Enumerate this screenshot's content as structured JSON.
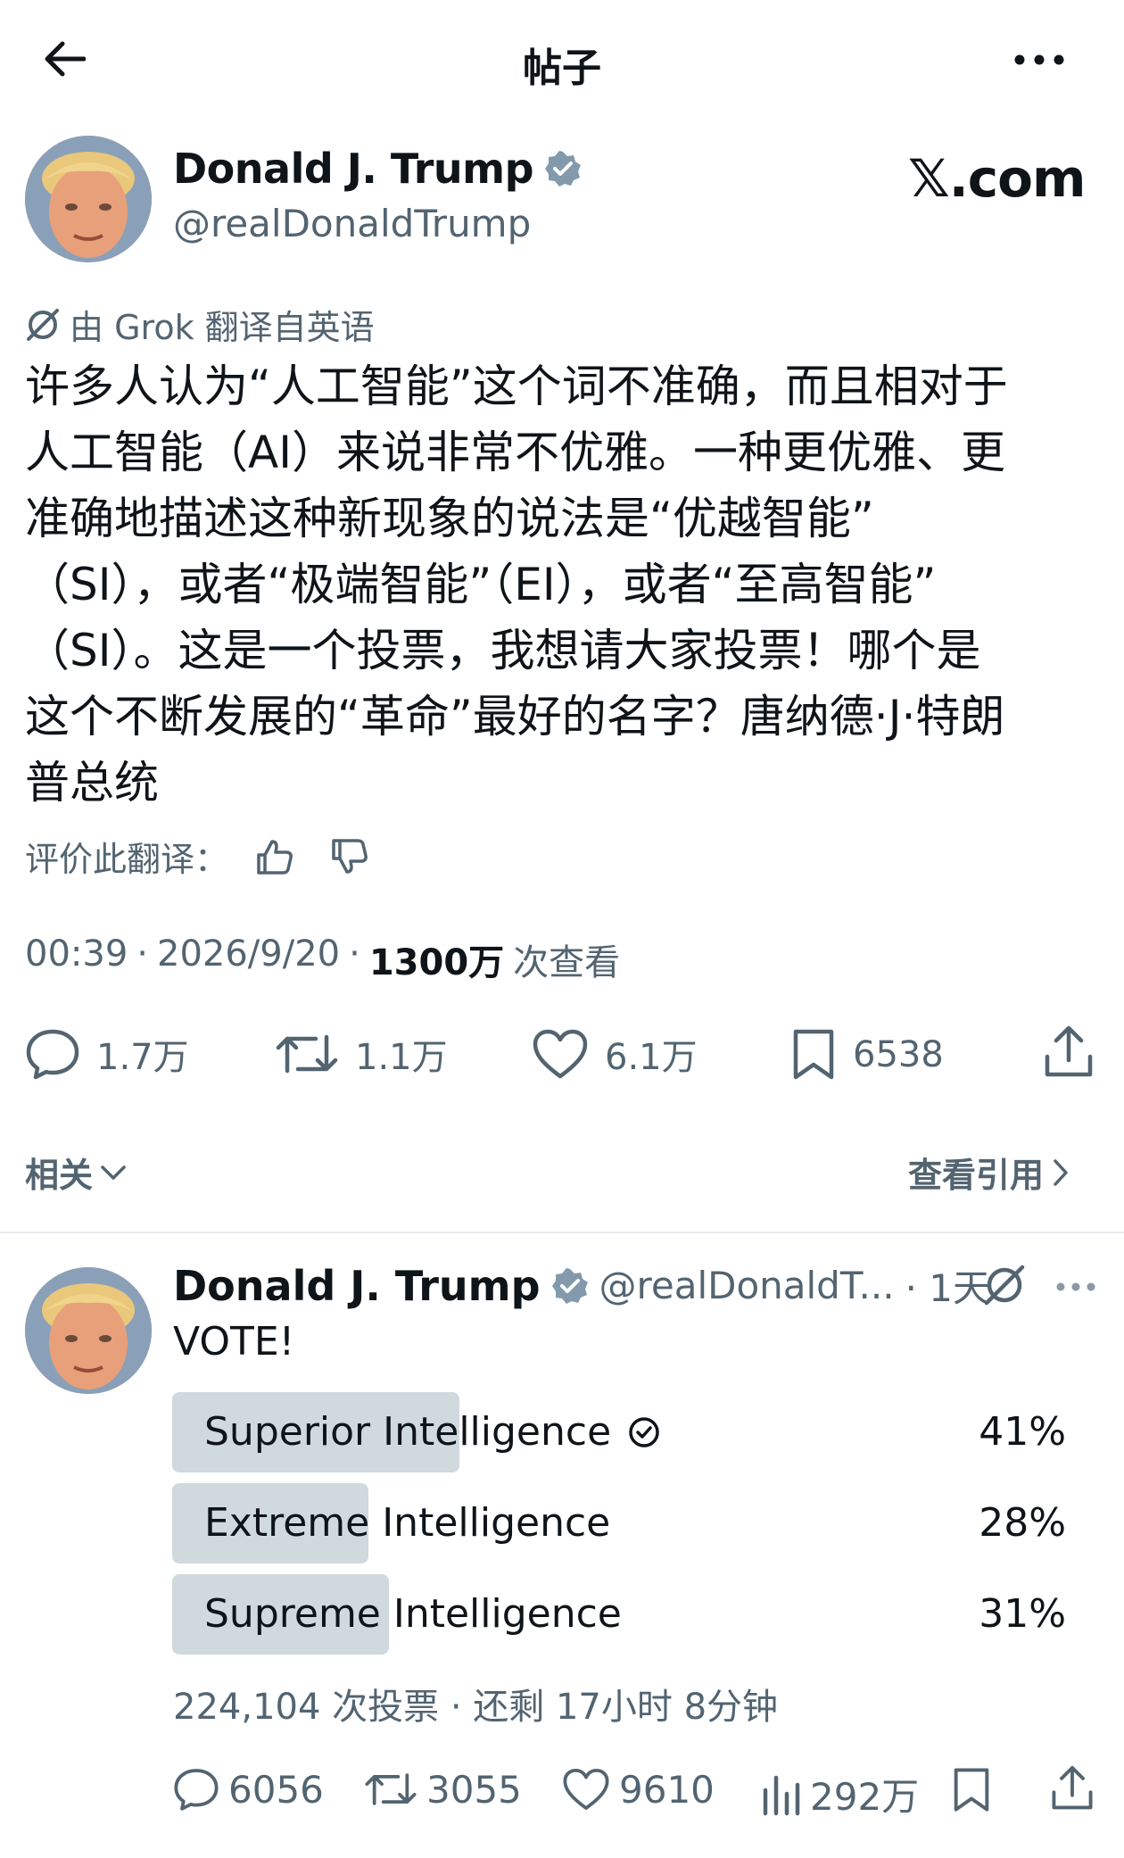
{
  "topbar": {
    "back_icon": "arrow-left-icon",
    "title": "帖子",
    "more_icon": "more-horizontal-icon"
  },
  "post": {
    "author": {
      "display_name": "Donald J. Trump",
      "handle": "@realDonaldTrump",
      "verified_color": "#829aab"
    },
    "watermark": "𝕏.com",
    "translation_notice": "由 Grok 翻译自英语",
    "body": "许多人认为“人工智能”这个词不准确，而且相对于\n人工智能（AI）来说非常不优雅。一种更优雅、更\n准确地描述这种新现象的说法是“优越智能”\n（SI），或者“极端智能”（EI），或者“至高智能”\n（SI）。这是一个投票，我想请大家投票！哪个是\n这个不断发展的“革命”最好的名字？唐纳德·J·特朗\n普总统",
    "rate_translation_label": "评价此翻译：",
    "meta": {
      "time": "00:39",
      "date": "2026/9/20",
      "views_count": "1300万",
      "views_label": "次查看"
    },
    "actions": {
      "replies": "1.7万",
      "reposts": "1.1万",
      "likes": "6.1万",
      "bookmarks": "6538"
    },
    "related_label": "相关",
    "view_quotes_label": "查看引用"
  },
  "reply": {
    "display_name": "Donald J. Trump",
    "handle": "@realDonaldT...",
    "time": "· 1天",
    "text": "VOTE!",
    "poll": {
      "options": [
        {
          "label": "Superior Intelligence",
          "percent_text": "41%",
          "percent": 41,
          "selected": true
        },
        {
          "label": "Extreme Intelligence",
          "percent_text": "28%",
          "percent": 28,
          "selected": false
        },
        {
          "label": "Supreme Intelligence",
          "percent_text": "31%",
          "percent": 31,
          "selected": false
        }
      ],
      "summary": "224,104 次投票 · 还剩 17小时 8分钟"
    },
    "actions": {
      "replies": "6056",
      "reposts": "3055",
      "likes": "9610",
      "views": "292万"
    }
  },
  "colors": {
    "text": "#0f1419",
    "muted": "#536471",
    "poll_fill": "#cfd9de",
    "divider": "#e6eaee"
  }
}
